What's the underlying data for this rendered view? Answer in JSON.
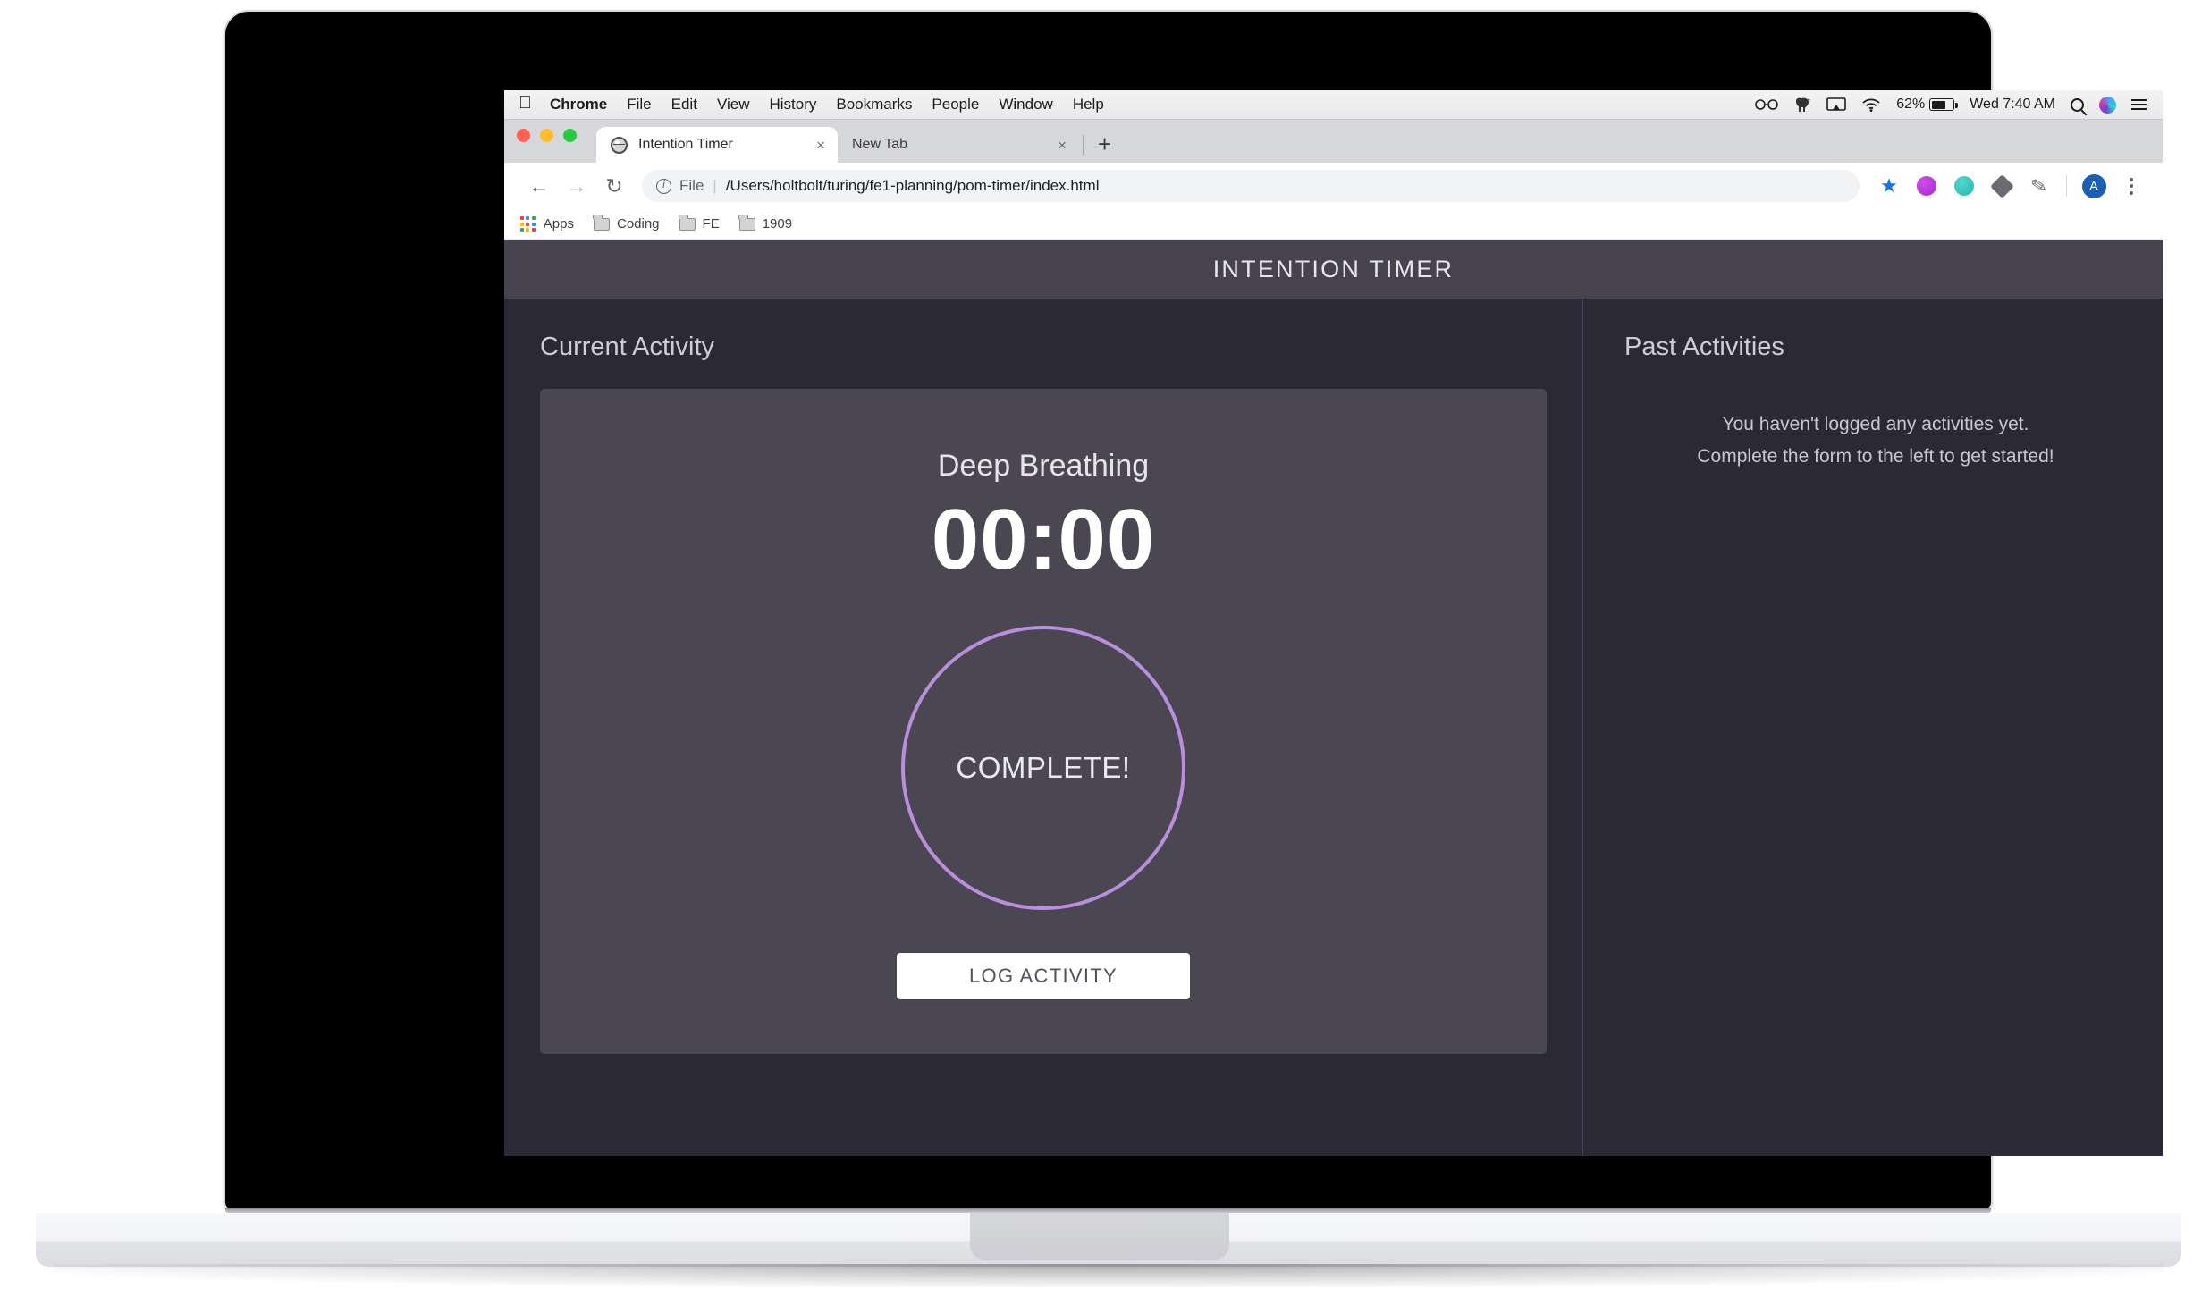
{
  "os": {
    "menubar": {
      "apple_logo": "",
      "items": [
        {
          "label": "Chrome",
          "bold": true
        },
        {
          "label": "File",
          "bold": false
        },
        {
          "label": "Edit",
          "bold": false
        },
        {
          "label": "View",
          "bold": false
        },
        {
          "label": "History",
          "bold": false
        },
        {
          "label": "Bookmarks",
          "bold": false
        },
        {
          "label": "People",
          "bold": false
        },
        {
          "label": "Window",
          "bold": false
        },
        {
          "label": "Help",
          "bold": false
        }
      ],
      "status": {
        "glasses_icon": "60",
        "battery_percent": "62%",
        "clock": "Wed 7:40 AM"
      }
    }
  },
  "browser": {
    "tabs": [
      {
        "title": "Intention Timer",
        "close": "×",
        "active": true
      },
      {
        "title": "New Tab",
        "close": "×",
        "active": false
      }
    ],
    "new_tab_label": "+",
    "nav": {
      "back": "←",
      "forward": "→",
      "reload": "↻"
    },
    "omnibox": {
      "scheme_label": "File",
      "separator": "|",
      "url": "/Users/holtbolt/turing/fe1-planning/pom-timer/index.html"
    },
    "toolbar_right": {
      "star": "★",
      "pen": "✎",
      "avatar_initial": "A"
    },
    "bookmarks": [
      {
        "label": "Apps",
        "icon": "apps-grid-icon"
      },
      {
        "label": "Coding",
        "icon": "folder-icon"
      },
      {
        "label": "FE",
        "icon": "folder-icon"
      },
      {
        "label": "1909",
        "icon": "folder-icon"
      }
    ]
  },
  "app": {
    "header_title": "INTENTION TIMER",
    "left_panel": {
      "title": "Current Activity",
      "activity_name": "Deep Breathing",
      "timer": "00:00",
      "circle_status": "COMPLETE!",
      "log_button": "LOG ACTIVITY"
    },
    "right_panel": {
      "title": "Past Activities",
      "empty_line_1": "You haven't logged any activities yet.",
      "empty_line_2": "Complete the form to the left to get started!"
    },
    "colors": {
      "page_background": "#2a2935",
      "header_band": "#46434f",
      "card_background": "#4a4752",
      "accent_purple": "#b98fdb",
      "text_primary": "#e8e6ec",
      "button_background": "#ffffff",
      "button_text": "#55525d"
    }
  }
}
